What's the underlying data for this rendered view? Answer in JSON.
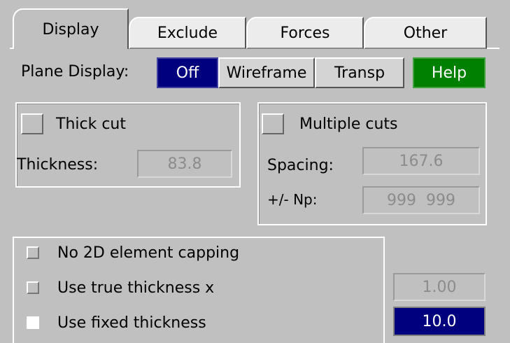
{
  "tabs": [
    {
      "label": "Display",
      "active": true
    },
    {
      "label": "Exclude",
      "active": false
    },
    {
      "label": "Forces",
      "active": false
    },
    {
      "label": "Other",
      "active": false
    }
  ],
  "plane_display": {
    "label": "Plane Display:",
    "options": [
      "Off",
      "Wireframe",
      "Transp"
    ],
    "selected": "Off",
    "help_label": "Help"
  },
  "thick_cut": {
    "checkbox_label": "Thick cut",
    "thickness_label": "Thickness:",
    "thickness_value": "83.8"
  },
  "multiple_cuts": {
    "checkbox_label": "Multiple cuts",
    "spacing_label": "Spacing:",
    "spacing_value": "167.6",
    "np_label": "+/- Np:",
    "np_value": "999  999"
  },
  "capping": {
    "options": [
      {
        "label": "No 2D element capping",
        "checked": false
      },
      {
        "label": "Use true thickness x",
        "checked": false
      },
      {
        "label": "Use fixed thickness",
        "checked": true
      }
    ],
    "true_thickness_value": "1.00",
    "fixed_thickness_value": "10.0"
  },
  "colors": {
    "background": "#c0c0c0",
    "selected": "#00007f",
    "help": "#008000"
  }
}
